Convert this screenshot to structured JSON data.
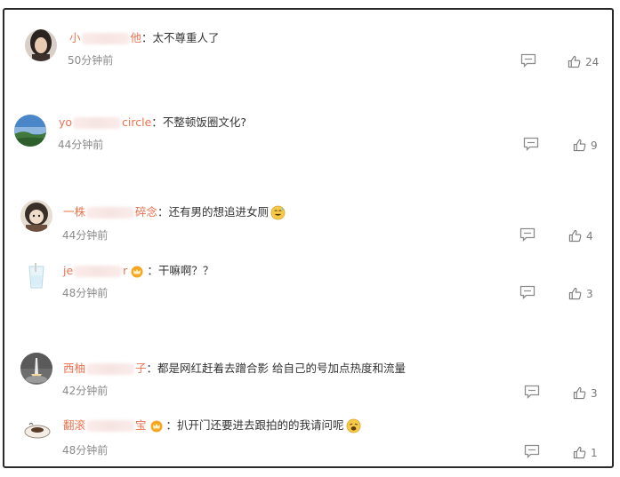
{
  "comments": [
    {
      "name_start": "小",
      "name_end": "他",
      "text": "太不尊重人了",
      "time": "50分钟前",
      "likes": "24",
      "crown": false,
      "emoji": "",
      "avatar": "woman-avatar"
    },
    {
      "name_start": "yo",
      "name_end": "circle",
      "text": "不整顿饭圈文化?",
      "time": "44分钟前",
      "likes": "9",
      "crown": false,
      "emoji": "",
      "avatar": "landscape-avatar"
    },
    {
      "name_start": "一株",
      "name_end": "碎念",
      "text": "还有男的想追进女厕",
      "time": "44分钟前",
      "likes": "4",
      "crown": false,
      "emoji": "sweat-smile-emoji",
      "avatar": "girl-avatar"
    },
    {
      "name_start": "je",
      "name_end": "r",
      "text": "干嘛啊？？",
      "time": "48分钟前",
      "likes": "3",
      "crown": true,
      "emoji": "",
      "avatar": "cup-avatar"
    },
    {
      "name_start": "西柚",
      "name_end": "子",
      "text": "都是网红赶着去蹭合影 给自己的号加点热度和流量",
      "time": "42分钟前",
      "likes": "3",
      "crown": false,
      "emoji": "",
      "avatar": "rocket-avatar"
    },
    {
      "name_start": "翻滚",
      "name_end": "宝",
      "text": "扒开门还要进去跟拍的的我请问呢",
      "time": "48分钟前",
      "likes": "1",
      "crown": true,
      "emoji": "tired-face-emoji",
      "avatar": "bowl-avatar"
    }
  ],
  "colors": {
    "username": "#eb7350",
    "text": "#333333",
    "meta": "#8a8a8a"
  }
}
